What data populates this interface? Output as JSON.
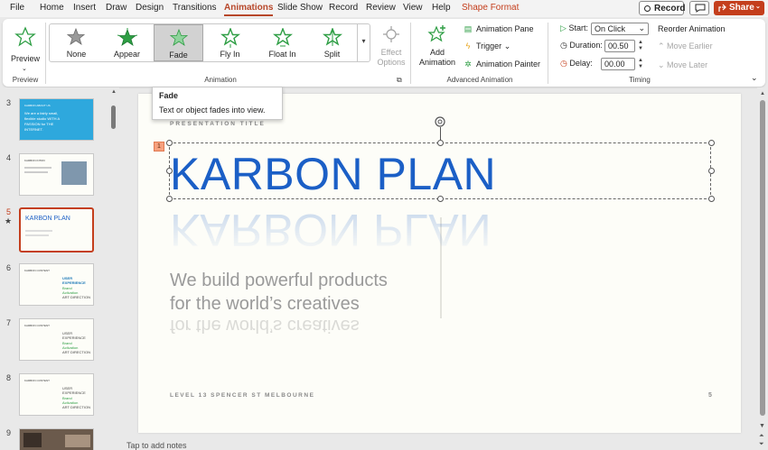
{
  "menu": {
    "tabs": [
      "File",
      "Home",
      "Insert",
      "Draw",
      "Design",
      "Transitions",
      "Animations",
      "Slide Show",
      "Record",
      "Review",
      "View",
      "Help",
      "Shape Format"
    ],
    "record_label": "Record",
    "share_label": "Share"
  },
  "ribbon": {
    "preview_label": "Preview",
    "preview_group": "Preview",
    "animations": [
      "None",
      "Appear",
      "Fade",
      "Fly In",
      "Float In",
      "Split"
    ],
    "selected_animation": "Fade",
    "effect_options": "Effect Options",
    "animation_group": "Animation",
    "add_animation": "Add Animation",
    "animation_pane": "Animation Pane",
    "trigger": "Trigger",
    "animation_painter": "Animation Painter",
    "advanced_group": "Advanced Animation",
    "start_label": "Start:",
    "start_value": "On Click",
    "duration_label": "Duration:",
    "duration_value": "00.50",
    "delay_label": "Delay:",
    "delay_value": "00.00",
    "reorder_label": "Reorder Animation",
    "move_earlier": "Move Earlier",
    "move_later": "Move Later",
    "timing_group": "Timing"
  },
  "tooltip": {
    "title": "Fade",
    "description": "Text or object fades into view."
  },
  "thumbnails": [
    {
      "num": "3",
      "title": "KARBON ABOUT US",
      "text": [
        "We are a fairly small,",
        "flexible studio WITH A",
        "PASSION for THE",
        "INTERNET."
      ]
    },
    {
      "num": "4",
      "title": "KARBON INTRO",
      "text": []
    },
    {
      "num": "5",
      "title": "KARBON PLAN",
      "text": []
    },
    {
      "num": "6",
      "title": "KARBON CONTENT",
      "text": [
        "USER",
        "EXPERIENCE",
        "Brand",
        "Activation",
        "ART DIRECTION"
      ]
    },
    {
      "num": "7",
      "title": "KARBON CONTENT",
      "text": [
        "USER",
        "EXPERIENCE",
        "Brand",
        "Activation",
        "ART DIRECTION"
      ]
    },
    {
      "num": "8",
      "title": "KARBON CONTENT",
      "text": [
        "USER",
        "EXPERIENCE",
        "Brand",
        "Activation",
        "ART DIRECTION"
      ]
    },
    {
      "num": "9",
      "title": "",
      "text": []
    }
  ],
  "slide": {
    "pres_title": "PRESENTATION TITLE",
    "anim_tag": "1",
    "title": "KARBON PLAN",
    "subtitle_1": "We build powerful products",
    "subtitle_2": "for the world’s creatives",
    "footer": "LEVEL 13 SPENCER ST MELBOURNE",
    "page": "5"
  },
  "notes_placeholder": "Tap to add notes",
  "colors": {
    "accent": "#c43e1c",
    "title_blue": "#1b5fc6",
    "star_green": "#2e9e44"
  }
}
